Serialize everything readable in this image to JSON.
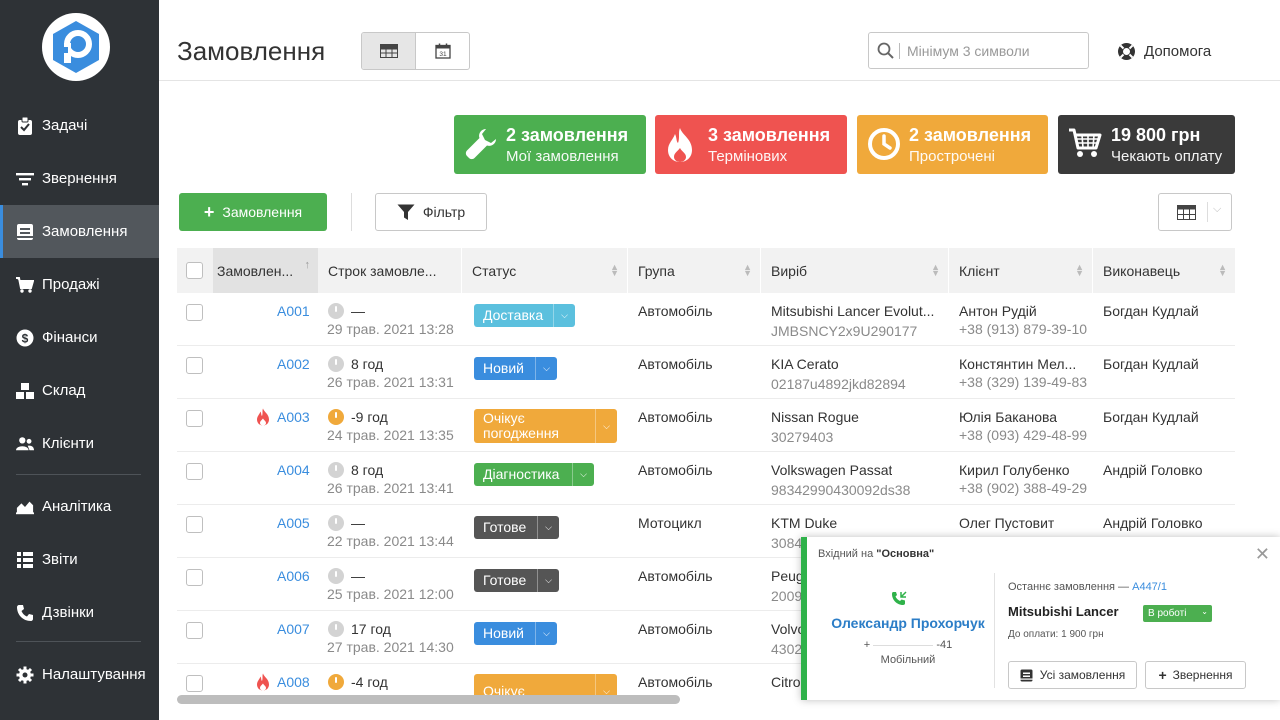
{
  "sidebar": {
    "items": [
      {
        "label": "Задачі",
        "icon": "clipboard-icon"
      },
      {
        "label": "Звернення",
        "icon": "filter-lines-icon"
      },
      {
        "label": "Замовлення",
        "icon": "orders-icon",
        "active": true
      },
      {
        "label": "Продажі",
        "icon": "cart-icon"
      },
      {
        "label": "Фінанси",
        "icon": "dollar-icon"
      },
      {
        "label": "Склад",
        "icon": "boxes-icon"
      },
      {
        "label": "Клієнти",
        "icon": "users-icon"
      },
      {
        "label": "Аналітика",
        "icon": "chart-area-icon"
      },
      {
        "label": "Звіти",
        "icon": "reports-icon"
      },
      {
        "label": "Дзвінки",
        "icon": "phone-icon"
      },
      {
        "label": "Налаштування",
        "icon": "gear-icon"
      }
    ]
  },
  "header": {
    "title": "Замовлення",
    "search_placeholder": "Мінімум 3 символи",
    "help_label": "Допомога"
  },
  "stats": [
    {
      "value": "2 замовлення",
      "label": "Мої замовлення",
      "color": "#4caf50",
      "icon": "wrench-icon"
    },
    {
      "value": "3 замовлення",
      "label": "Термінових",
      "color": "#ef5350",
      "icon": "flame-icon"
    },
    {
      "value": "2 замовлення",
      "label": "Прострочені",
      "color": "#f0a93b",
      "icon": "clock-icon"
    },
    {
      "value": "19 800 грн",
      "label": "Чекають оплату",
      "color": "#3a3a3a",
      "icon": "cart-icon"
    }
  ],
  "toolbar": {
    "add_label": "Замовлення",
    "filter_label": "Фільтр"
  },
  "table": {
    "columns": [
      "Замовлен...",
      "Строк замовле...",
      "Статус",
      "Група",
      "Виріб",
      "Клієнт",
      "Виконавець"
    ],
    "rows": [
      {
        "id": "A001",
        "urgent": false,
        "overdue": false,
        "deadline": "—",
        "date": "29 трав. 2021 13:28",
        "status": "Доставка",
        "status_color": "#5bc0de",
        "group": "Автомобіль",
        "product": "Mitsubishi Lancer Evolut...",
        "serial": "JMBSNCY2x9U290177",
        "client": "Антон Рудій",
        "phone": "+38 (913) 879-39-10",
        "executor": "Богдан Кудлай"
      },
      {
        "id": "A002",
        "urgent": false,
        "overdue": false,
        "deadline": "8 год",
        "date": "26 трав. 2021 13:31",
        "status": "Новий",
        "status_color": "#3a8dde",
        "group": "Автомобіль",
        "product": "KIA Cerato",
        "serial": "02187u4892jkd82894",
        "client": "Констянтин Мел...",
        "phone": "+38 (329) 139-49-83",
        "executor": "Богдан Кудлай"
      },
      {
        "id": "A003",
        "urgent": true,
        "overdue": true,
        "deadline": "-9 год",
        "date": "24 трав. 2021 13:35",
        "status": "Очікує погодження",
        "status_color": "#f0a93b",
        "group": "Автомобіль",
        "product": "Nissan Rogue",
        "serial": "30279403",
        "client": "Юлія Баканова",
        "phone": "+38 (093) 429-48-99",
        "executor": "Богдан Кудлай"
      },
      {
        "id": "A004",
        "urgent": false,
        "overdue": false,
        "deadline": "8 год",
        "date": "26 трав. 2021 13:41",
        "status": "Діагностика",
        "status_color": "#4caf50",
        "group": "Автомобіль",
        "product": "Volkswagen Passat",
        "serial": "98342990430092ds38",
        "client": "Кирил Голубенко",
        "phone": "+38 (902) 388-49-29",
        "executor": "Андрій Головко"
      },
      {
        "id": "A005",
        "urgent": false,
        "overdue": false,
        "deadline": "—",
        "date": "22 трав. 2021 13:44",
        "status": "Готове",
        "status_color": "#555555",
        "group": "Мотоцикл",
        "product": "KTM Duke",
        "serial": "3084",
        "client": "Олег Пустовит",
        "phone": "",
        "executor": "Андрій Головко"
      },
      {
        "id": "A006",
        "urgent": false,
        "overdue": false,
        "deadline": "—",
        "date": "25 трав. 2021 12:00",
        "status": "Готове",
        "status_color": "#555555",
        "group": "Автомобіль",
        "product": "Peug",
        "serial": "2009",
        "client": "",
        "phone": "",
        "executor": ""
      },
      {
        "id": "A007",
        "urgent": false,
        "overdue": false,
        "deadline": "17 год",
        "date": "27 трав. 2021 14:30",
        "status": "Новий",
        "status_color": "#3a8dde",
        "group": "Автомобіль",
        "product": "Volvo",
        "serial": "4302",
        "client": "",
        "phone": "",
        "executor": ""
      },
      {
        "id": "A008",
        "urgent": true,
        "overdue": true,
        "deadline": "-4 год",
        "date": "",
        "status": "Очікує",
        "status_color": "#f0a93b",
        "group": "Автомобіль",
        "product": "Citro",
        "serial": "",
        "client": "",
        "phone": "",
        "executor": ""
      }
    ]
  },
  "call": {
    "incoming_prefix": "Вхідний на",
    "line": "\"Основна\"",
    "caller": "Олександр Прохорчук",
    "number_start": "+",
    "number_end": "-41",
    "number_type": "Мобільний",
    "last_order_label": "Останнє замовлення —",
    "last_order_id": "A447/1",
    "car": "Mitsubishi Lancer",
    "status": "В роботі",
    "due": "До оплати: 1 900 грн",
    "all_orders_label": "Усі замовлення",
    "appeal_label": "Звернення"
  }
}
